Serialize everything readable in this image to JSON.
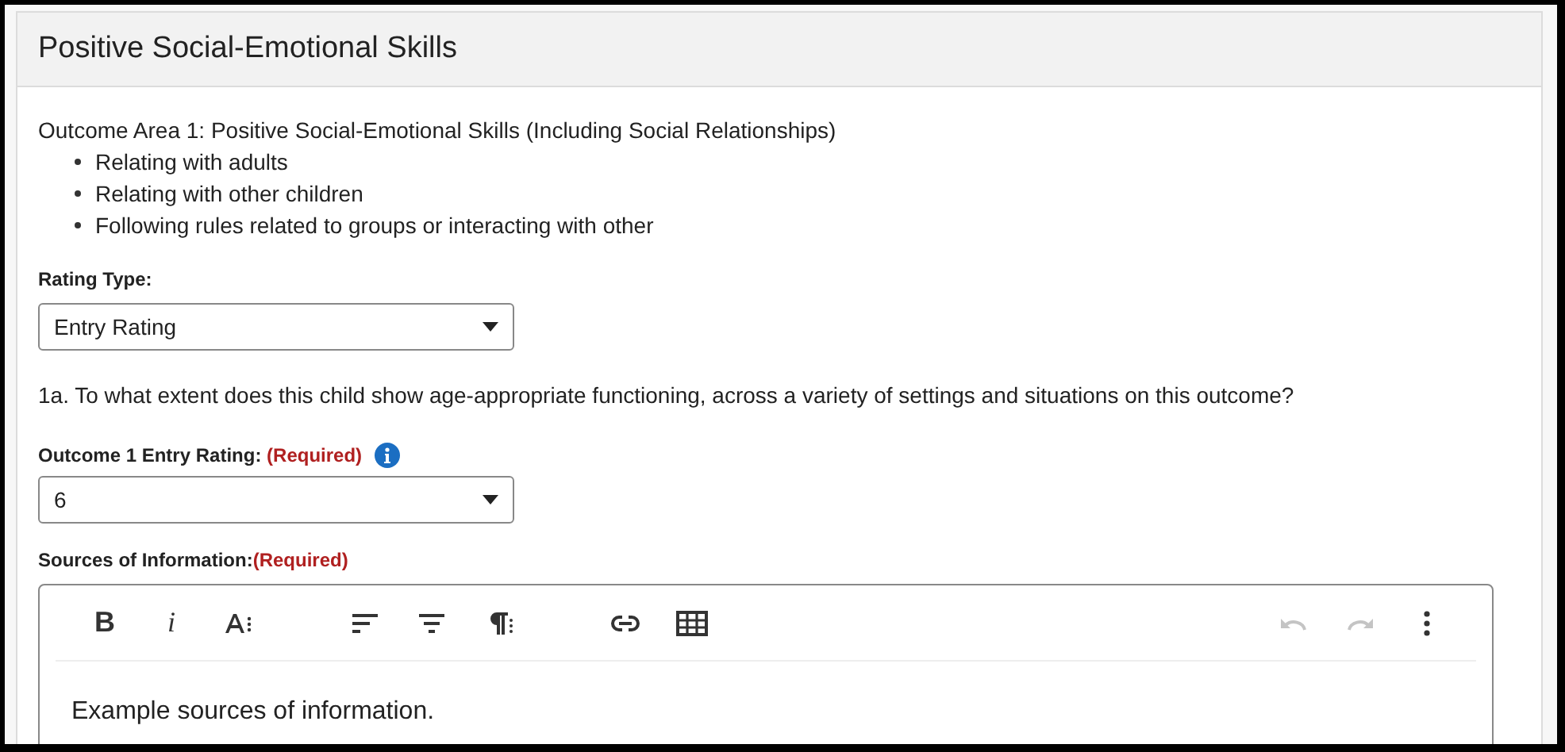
{
  "panel": {
    "title": "Positive Social-Emotional Skills"
  },
  "intro": "Outcome Area 1: Positive Social-Emotional Skills (Including Social Relationships)",
  "bullets": [
    "Relating with adults",
    "Relating with other children",
    "Following rules related to groups or interacting with other"
  ],
  "rating_type": {
    "label": "Rating Type:",
    "value": "Entry Rating"
  },
  "question": "1a. To what extent does this child show age-appropriate functioning, across a variety of settings and situations on this outcome?",
  "entry_rating": {
    "label": "Outcome 1 Entry Rating:",
    "required": "(Required)",
    "value": "6"
  },
  "sources": {
    "label": "Sources of Information:",
    "required": "(Required)",
    "content": "Example sources of information."
  },
  "toolbar": [
    {
      "kind": "bold",
      "label": "B",
      "disabled": false
    },
    {
      "kind": "italic",
      "label": "i",
      "disabled": false
    },
    {
      "kind": "font-size",
      "disabled": false
    },
    {
      "kind": "gap"
    },
    {
      "kind": "align-left",
      "disabled": false
    },
    {
      "kind": "align-center",
      "disabled": false
    },
    {
      "kind": "paragraph",
      "disabled": false
    },
    {
      "kind": "gap"
    },
    {
      "kind": "link",
      "disabled": false
    },
    {
      "kind": "table",
      "disabled": false
    },
    {
      "kind": "spacer"
    },
    {
      "kind": "undo",
      "disabled": true
    },
    {
      "kind": "redo",
      "disabled": true
    },
    {
      "kind": "more",
      "disabled": false
    }
  ]
}
